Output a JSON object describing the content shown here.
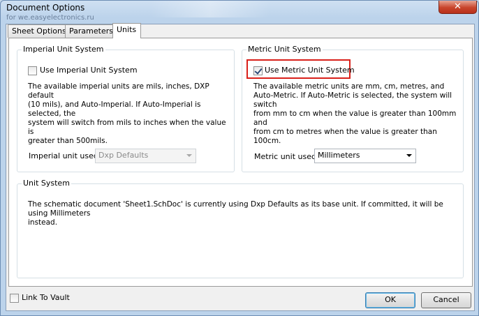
{
  "window": {
    "title": "Document Options",
    "watermark": "for we.easyelectronics.ru",
    "close_label": "✕"
  },
  "tabs": [
    {
      "label": "Sheet Options",
      "active": false
    },
    {
      "label": "Parameters",
      "active": false
    },
    {
      "label": "Units",
      "active": true
    }
  ],
  "imperial": {
    "group_label": "Imperial Unit System",
    "checkbox_label": "Use Imperial Unit System",
    "checked": false,
    "description_lines": [
      "The available imperial units are mils, inches, DXP default",
      "(10 mils), and Auto-Imperial. If Auto-Imperial is selected, the",
      "system will switch from mils to inches when the value is",
      "greater than 500mils."
    ],
    "unit_label": "Imperial unit used",
    "unit_value": "Dxp Defaults"
  },
  "metric": {
    "group_label": "Metric Unit System",
    "checkbox_label": "Use Metric Unit System",
    "checked": true,
    "description_lines": [
      "The available metric units are mm, cm,  metres, and",
      "Auto-Metric. If Auto-Metric is selected, the system will switch",
      "from mm to cm when the value is greater than 100mm and",
      "from cm to metres when the value is greater than 100cm."
    ],
    "unit_label": "Metric unit used",
    "unit_value": "Millimeters"
  },
  "unit_system": {
    "group_label": "Unit  System",
    "text_lines": [
      "The schematic document 'Sheet1.SchDoc' is currently using Dxp Defaults as its base unit. If committed, it will be using Millimeters",
      "instead."
    ]
  },
  "footer": {
    "vault_label": "Link To Vault",
    "ok_label": "OK",
    "cancel_label": "Cancel"
  },
  "colors": {
    "highlight": "#d9201a",
    "close_button": "#c8452c"
  }
}
